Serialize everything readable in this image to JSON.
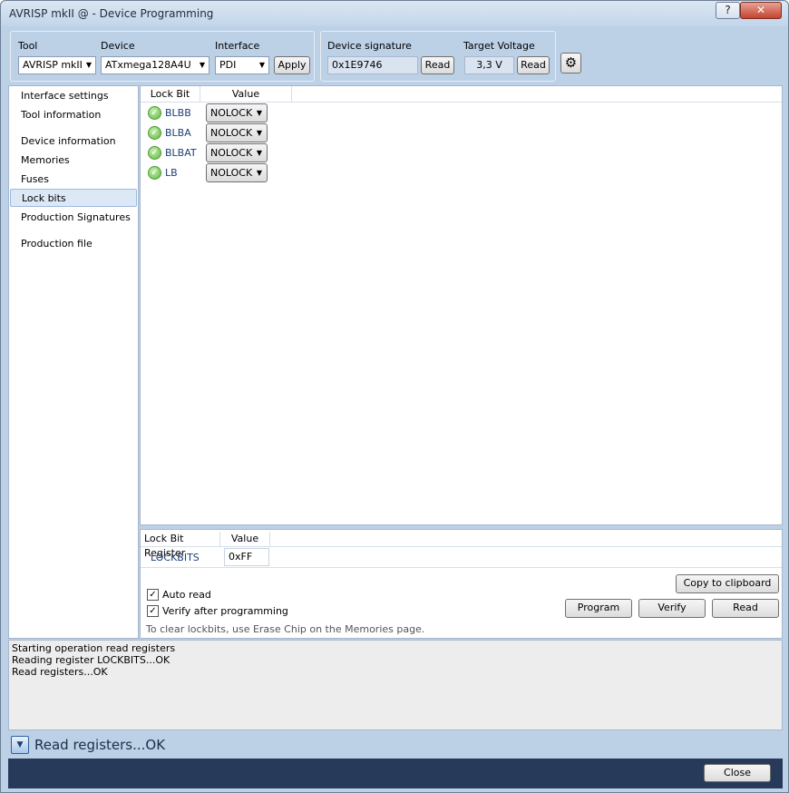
{
  "window": {
    "title": "AVRISP mkII @  - Device Programming",
    "help_label": "?",
    "close_label": "✕"
  },
  "toolbar": {
    "tool_label": "Tool",
    "tool_value": "AVRISP mkII",
    "device_label": "Device",
    "device_value": "ATxmega128A4U",
    "interface_label": "Interface",
    "interface_value": "PDI",
    "apply_label": "Apply",
    "signature_label": "Device signature",
    "signature_value": "0x1E9746",
    "signature_read_label": "Read",
    "voltage_label": "Target Voltage",
    "voltage_value": "3,3 V",
    "voltage_read_label": "Read"
  },
  "sidebar": {
    "items": [
      {
        "label": "Interface settings"
      },
      {
        "label": "Tool information"
      },
      {
        "label": "Device information"
      },
      {
        "label": "Memories"
      },
      {
        "label": "Fuses"
      },
      {
        "label": "Lock bits"
      },
      {
        "label": "Production Signatures"
      },
      {
        "label": "Production file"
      }
    ],
    "selected": "Lock bits"
  },
  "lockbits": {
    "col_lock_bit": "Lock Bit",
    "col_value": "Value",
    "rows": [
      {
        "name": "BLBB",
        "value": "NOLOCK"
      },
      {
        "name": "BLBA",
        "value": "NOLOCK"
      },
      {
        "name": "BLBAT",
        "value": "NOLOCK"
      },
      {
        "name": "LB",
        "value": "NOLOCK"
      }
    ]
  },
  "register": {
    "col_register": "Lock Bit Register",
    "col_value": "Value",
    "name": "LOCKBITS",
    "value": "0xFF"
  },
  "actions": {
    "auto_read_label": "Auto read",
    "auto_read_checked": true,
    "verify_label": "Verify after programming",
    "verify_checked": true,
    "copy_label": "Copy to clipboard",
    "program_label": "Program",
    "verify_button_label": "Verify",
    "read_label": "Read",
    "hint": "To clear lockbits, use Erase Chip on the Memories page."
  },
  "log": {
    "lines": [
      "Starting operation read registers",
      "Reading register LOCKBITS...OK",
      "Read registers...OK"
    ]
  },
  "status": {
    "text": "Read registers...OK"
  },
  "footer": {
    "close_label": "Close"
  }
}
